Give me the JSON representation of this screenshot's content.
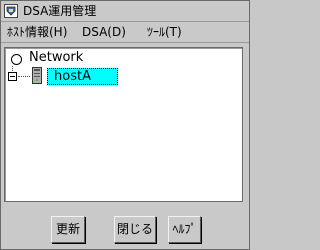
{
  "window": {
    "title": "DSA運用管理"
  },
  "menu": {
    "items": [
      {
        "label": "ﾎｽﾄ情報(H)"
      },
      {
        "label": "DSA(D)"
      },
      {
        "label": "ﾂｰﾙ(T)"
      }
    ]
  },
  "tree": {
    "root": {
      "label": "Network",
      "icon": "radio-icon"
    },
    "children": [
      {
        "label": "hostA",
        "icon": "server-icon",
        "selected": true,
        "expanded": true
      }
    ]
  },
  "buttons": {
    "refresh": "更新",
    "close": "閉じる",
    "help": "ﾍﾙﾌﾟ"
  },
  "colors": {
    "selection": "#00ffff",
    "background": "#c9c9c9"
  }
}
